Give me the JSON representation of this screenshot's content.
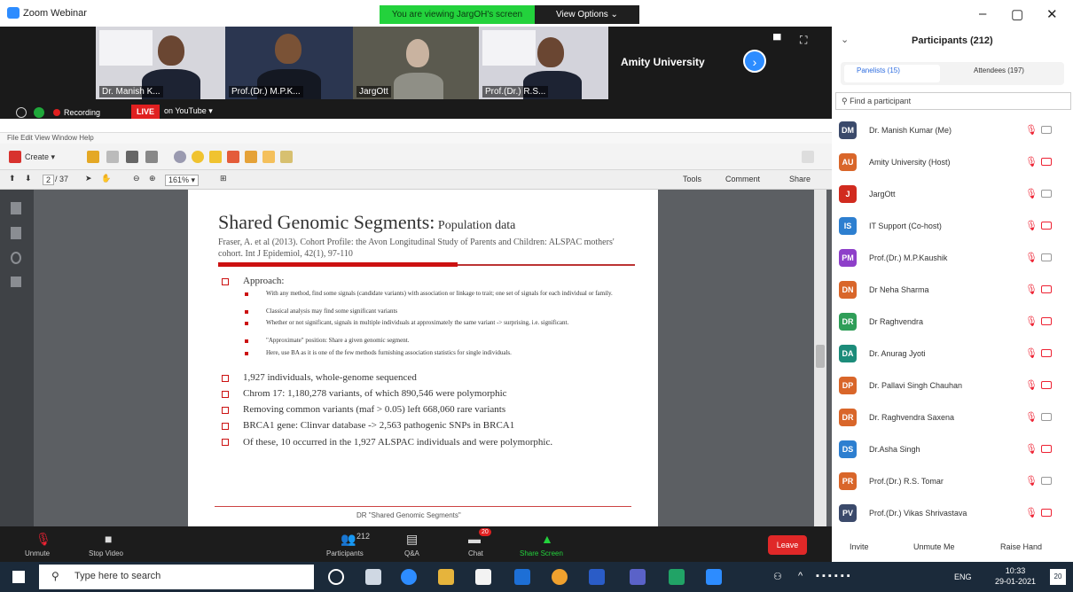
{
  "window": {
    "title": "Zoom Webinar"
  },
  "banner": {
    "viewing": "You are viewing JargOH's screen",
    "view_options": "View Options ⌄"
  },
  "window_controls": {
    "minimize": "–",
    "maximize": "▢",
    "close": "✕"
  },
  "videos": [
    {
      "label": "Dr. Manish K..."
    },
    {
      "label": "Prof.(Dr.) M.P.K..."
    },
    {
      "label": "JargOtt"
    },
    {
      "label": "Prof.(Dr.) R.S..."
    }
  ],
  "amity_label": "Amity University",
  "recording": {
    "label": "Recording",
    "live": "LIVE",
    "youtube": "on YouTube ▾"
  },
  "acrobat": {
    "menu": "File  Edit  View  Window  Help",
    "create": "Create ▾",
    "page_num": "2",
    "page_total": "/ 37",
    "zoom": "161% ▾",
    "tools": "Tools",
    "comment": "Comment",
    "share": "Share"
  },
  "slide": {
    "title": "Shared Genomic Segments:",
    "title_sub": " Population data",
    "citation": "Fraser, A. et al (2013). Cohort Profile: the Avon Longitudinal Study of Parents and Children: ALSPAC mothers' cohort. Int J Epidemiol, 42(1), 97-110",
    "approach": "Approach:",
    "sub_bullets": [
      "With any method, find some signals (candidate variants) with association or linkage to trait; one set of signals for each individual or family.",
      "Classical analysis may find some significant variants",
      "Whether or not significant, signals in multiple individuals at approximately the same variant -> surprising, i.e. significant.",
      "\"Approximate\" position: Share a given genomic segment.",
      "Here, use BA as it is one of the few methods furnishing association statistics for single individuals."
    ],
    "bullets": [
      "1,927 individuals, whole-genome sequenced",
      "Chrom 17: 1,180,278 variants, of which 890,546 were polymorphic",
      "Removing common variants (maf > 0.05) left 668,060 rare variants",
      "BRCA1 gene: Clinvar database -> 2,563 pathogenic SNPs in BRCA1",
      "Of these, 10 occurred in the 1,927 ALSPAC individuals and were polymorphic."
    ],
    "footer": "DR \"Shared Genomic Segments\""
  },
  "participants": {
    "title": "Participants (212)",
    "tab_panelists": "Panelists (15)",
    "tab_attendees": "Attendees (197)",
    "search_placeholder": "Find a participant",
    "list": [
      {
        "initials": "DM",
        "name": "Dr. Manish Kumar (Me)",
        "color": "#3b4a6b",
        "cam_off": false
      },
      {
        "initials": "AU",
        "name": "Amity University (Host)",
        "color": "#d9662a",
        "cam_off": true
      },
      {
        "initials": "J",
        "name": "JargOtt",
        "color": "#d12b1f",
        "cam_off": false
      },
      {
        "initials": "IS",
        "name": "IT Support (Co-host)",
        "color": "#2d7fd0",
        "cam_off": true
      },
      {
        "initials": "PM",
        "name": "Prof.(Dr.) M.P.Kaushik",
        "color": "#8e3fc9",
        "cam_off": false
      },
      {
        "initials": "DN",
        "name": "Dr Neha Sharma",
        "color": "#d9662a",
        "cam_off": true
      },
      {
        "initials": "DR",
        "name": "Dr Raghvendra",
        "color": "#2f9e58",
        "cam_off": true
      },
      {
        "initials": "DA",
        "name": "Dr. Anurag Jyoti",
        "color": "#1c8c7a",
        "cam_off": true
      },
      {
        "initials": "DP",
        "name": "Dr. Pallavi Singh Chauhan",
        "color": "#d9662a",
        "cam_off": true
      },
      {
        "initials": "DR",
        "name": "Dr. Raghvendra Saxena",
        "color": "#d9662a",
        "cam_off": false
      },
      {
        "initials": "DS",
        "name": "Dr.Asha Singh",
        "color": "#2d7fd0",
        "cam_off": true
      },
      {
        "initials": "PR",
        "name": "Prof.(Dr.) R.S. Tomar",
        "color": "#d9662a",
        "cam_off": false
      },
      {
        "initials": "PV",
        "name": "Prof.(Dr.) Vikas Shrivastava",
        "color": "#3b4a6b",
        "cam_off": true
      }
    ],
    "invite": "Invite",
    "unmute_me": "Unmute Me",
    "raise_hand": "Raise Hand"
  },
  "controls": {
    "unmute": "Unmute",
    "stop_video": "Stop Video",
    "participants": "Participants",
    "participants_count": "212",
    "qa": "Q&A",
    "chat": "Chat",
    "chat_badge": "20",
    "share_screen": "Share Screen",
    "leave": "Leave"
  },
  "taskbar": {
    "search_placeholder": "Type here to search",
    "lang": "ENG",
    "time": "10:33",
    "date": "29-01-2021",
    "notif": "20"
  },
  "colors": {
    "zoom_blue": "#2d8cff",
    "live_red": "#e02020",
    "banner_green": "#23d23c",
    "slide_red": "#c11111"
  }
}
